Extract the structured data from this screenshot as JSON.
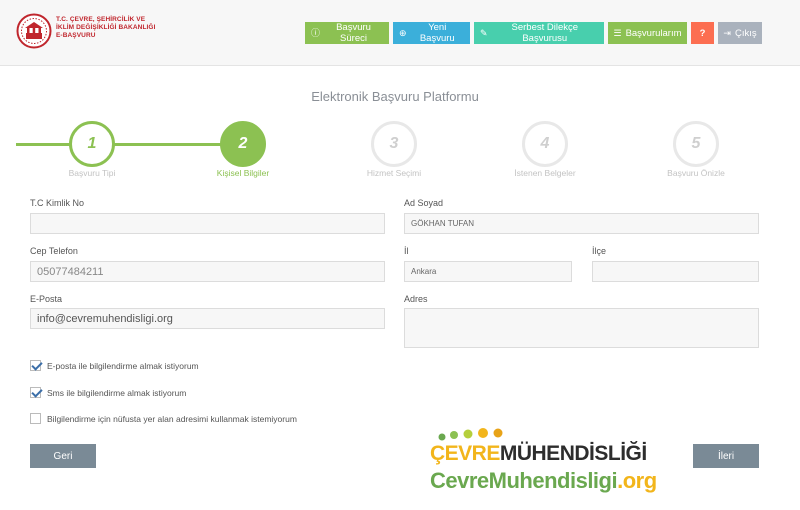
{
  "header": {
    "logo_lines": [
      "T.C. ÇEVRE, ŞEHİRCİLİK VE",
      "İKLİM DEĞİŞİKLİĞİ BAKANLIĞI",
      "E-BAŞVURU"
    ],
    "nav": {
      "surec": {
        "label": "Başvuru Süreci",
        "icon": "info-icon"
      },
      "yeni": {
        "label": "Yeni Başvuru",
        "icon": "plus-icon"
      },
      "serbest": {
        "label": "Serbest Dilekçe Başvurusu",
        "icon": "pencil-icon"
      },
      "basvurular": {
        "label": "Başvurularım",
        "icon": "list-icon"
      },
      "help": {
        "label": "?",
        "icon": "help-icon"
      },
      "cikis": {
        "label": "Çıkış",
        "icon": "logout-icon"
      }
    }
  },
  "platform_title": "Elektronik Başvuru Platformu",
  "steps": [
    {
      "number": "1",
      "label": "Başvuru Tipi",
      "state": "done"
    },
    {
      "number": "2",
      "label": "Kişisel Bilgiler",
      "state": "current"
    },
    {
      "number": "3",
      "label": "Hizmet Seçimi",
      "state": "pending"
    },
    {
      "number": "4",
      "label": "İstenen Belgeler",
      "state": "pending"
    },
    {
      "number": "5",
      "label": "Başvuru Önizle",
      "state": "pending"
    }
  ],
  "form": {
    "tc": {
      "label": "T.C Kimlik No",
      "value": ""
    },
    "adsoyad": {
      "label": "Ad Soyad",
      "value": "GÖKHAN TUFAN"
    },
    "telefon": {
      "label": "Cep Telefon",
      "value": "05077484211"
    },
    "il": {
      "label": "İl",
      "value": "Ankara"
    },
    "ilce": {
      "label": "İlçe",
      "value": ""
    },
    "eposta": {
      "label": "E-Posta",
      "value": "info@cevremuhendisligi.org"
    },
    "adres": {
      "label": "Adres",
      "value": ""
    }
  },
  "checkboxes": [
    {
      "label": "E-posta ile bilgilendirme almak istiyorum",
      "checked": true
    },
    {
      "label": "Sms ile bilgilendirme almak istiyorum",
      "checked": true
    },
    {
      "label": "Bilgilendirme için nüfusta yer alan adresimi kullanmak istemiyorum",
      "checked": false
    }
  ],
  "buttons": {
    "back": "Geri",
    "next": "İleri"
  },
  "watermark": {
    "line1_a": "ÇEVRE",
    "line1_b": "MÜHENDİSLİĞİ",
    "line2_a": "CevreMuhendisligi",
    "line2_b": ".org"
  },
  "colors": {
    "accent_green": "#8cc152",
    "brand_red": "#c0262d",
    "button_gray": "#7a8a96"
  }
}
